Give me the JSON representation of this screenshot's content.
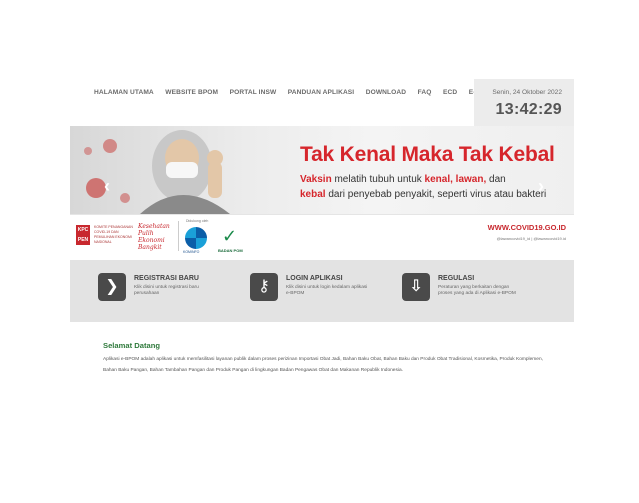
{
  "nav": {
    "items": [
      "HALAMAN UTAMA",
      "WEBSITE BPOM",
      "PORTAL INSW",
      "PANDUAN APLIKASI",
      "DOWNLOAD",
      "FAQ",
      "ECD",
      "E-CPP"
    ]
  },
  "clock": {
    "date": "Senin, 24 Oktober 2022",
    "time": "13:42:29"
  },
  "banner": {
    "headline": "Tak Kenal Maka Tak Kebal",
    "line1_highlight": "Vaksin",
    "line1_text": " melatih tubuh untuk ",
    "line1_red": "kenal, lawan,",
    "line1_end": " dan",
    "line2_highlight": "kebal",
    "line2_text": " dari penyebab penyakit, seperti virus atau bakteri",
    "kpc": "KPC PEN",
    "kpc_caption": "KOMITE PENANGANAN COVID-19 DAN PEMULIHAN EKONOMI NASIONAL",
    "slogan": "Kesehatan Pulih Ekonomi Bangkit",
    "support_label": "Didukung oleh",
    "kominfo": "KOMINFO",
    "bpom": "BADAN POM",
    "url": "WWW.COVID19.GO.ID",
    "social": "@lawancovid19_id  |  @lawancovid19.id",
    "prev_arrow": "‹",
    "next_arrow": "›"
  },
  "quick_links": [
    {
      "icon": "arrow-right-icon",
      "glyph": "❯",
      "title": "REGISTRASI BARU",
      "desc": "Klik disini untuk registrasi baru perusahaan"
    },
    {
      "icon": "key-icon",
      "glyph": "⚷",
      "title": "LOGIN APLIKASI",
      "desc": "Klik disini untuk login kedalam aplikasi e-BPOM"
    },
    {
      "icon": "download-icon",
      "glyph": "⇩",
      "title": "REGULASI",
      "desc": "Peraturan yang berkaitan dengan proses yang ada di Aplikasi e-BPOM"
    }
  ],
  "welcome": {
    "title": "Selamat Datang",
    "body": "Aplikasi e-BPOM adalah aplikasi untuk memfasilitasi layanan publik dalam proses perizinan Importasi Obat Jadi, Bahan Baku Obat, Bahan Baku dan Produk Obat Tradisional, Kosmetika, Produk Komplemen, Bahan Baku Pangan, Bahan Tambahan Pangan dan Produk Pangan di lingkungan Badan Pengawas Obat dan Makanan Republik Indonesia."
  },
  "colors": {
    "accent_red": "#d6262c",
    "welcome_green": "#2f7a3c",
    "quick_bg": "#e3e3e3"
  }
}
